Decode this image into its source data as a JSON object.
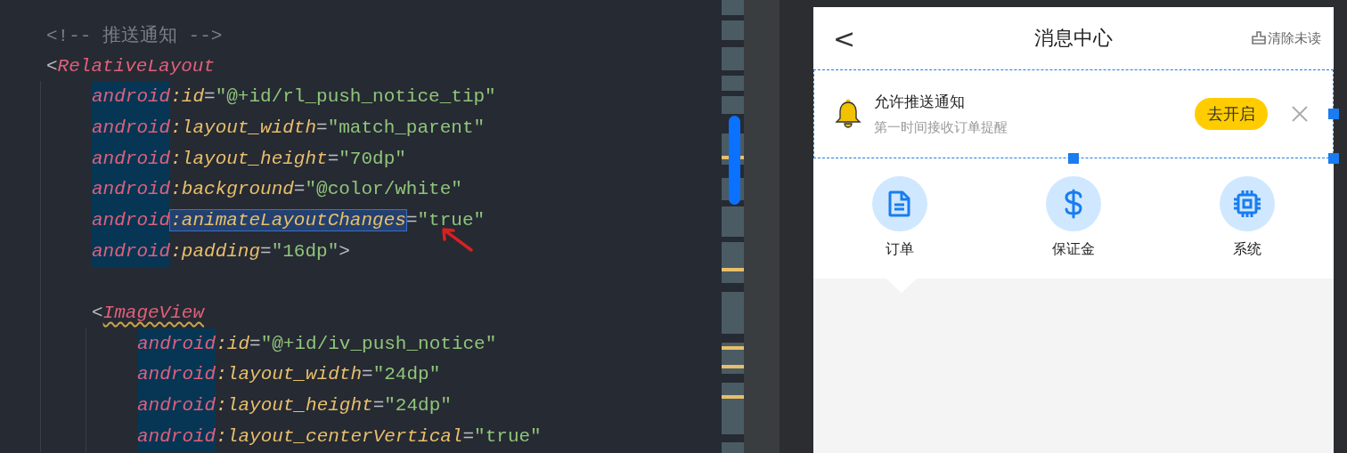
{
  "editor": {
    "nodes": [
      {
        "kind": "comment",
        "text": "<!-- 推送通知 -->"
      },
      {
        "kind": "tag",
        "open": "<",
        "name": "RelativeLayout",
        "warning": false,
        "close": ">",
        "attrs": [
          {
            "prefix": "android",
            "name": ":id",
            "eq": "=",
            "value": "\"@+id/rl_push_notice_tip\"",
            "highlighted": false
          },
          {
            "prefix": "android",
            "name": ":layout_width",
            "eq": "=",
            "value": "\"match_parent\"",
            "highlighted": false
          },
          {
            "prefix": "android",
            "name": ":layout_height",
            "eq": "=",
            "value": "\"70dp\"",
            "highlighted": false
          },
          {
            "prefix": "android",
            "name": ":background",
            "eq": "=",
            "value": "\"@color/white\"",
            "highlighted": false
          },
          {
            "prefix": "android",
            "name": ":animateLayoutChanges",
            "eq": "=",
            "value": "\"true\"",
            "highlighted": true
          },
          {
            "prefix": "android",
            "name": ":padding",
            "eq": "=",
            "value": "\"16dp\"",
            "highlighted": false
          }
        ],
        "children": [
          {
            "kind": "tag",
            "open": "<",
            "name": "ImageView",
            "warning": true,
            "attrs": [
              {
                "prefix": "android",
                "name": ":id",
                "eq": "=",
                "value": "\"@+id/iv_push_notice\"",
                "highlighted": false
              },
              {
                "prefix": "android",
                "name": ":layout_width",
                "eq": "=",
                "value": "\"24dp\"",
                "highlighted": false
              },
              {
                "prefix": "android",
                "name": ":layout_height",
                "eq": "=",
                "value": "\"24dp\"",
                "highlighted": false
              },
              {
                "prefix": "android",
                "name": ":layout_centerVertical",
                "eq": "=",
                "value": "\"true\"",
                "highlighted": false
              }
            ]
          }
        ]
      }
    ]
  },
  "preview": {
    "back": "<",
    "title": "消息中心",
    "action": "清除未读",
    "banner": {
      "title": "允许推送通知",
      "subtitle": "第一时间接收订单提醒",
      "button": "去开启",
      "selected": true
    },
    "categories": [
      {
        "kind": "document",
        "label": "订单"
      },
      {
        "kind": "dollar",
        "label": "保证金"
      },
      {
        "kind": "chip",
        "label": "系统"
      }
    ]
  }
}
